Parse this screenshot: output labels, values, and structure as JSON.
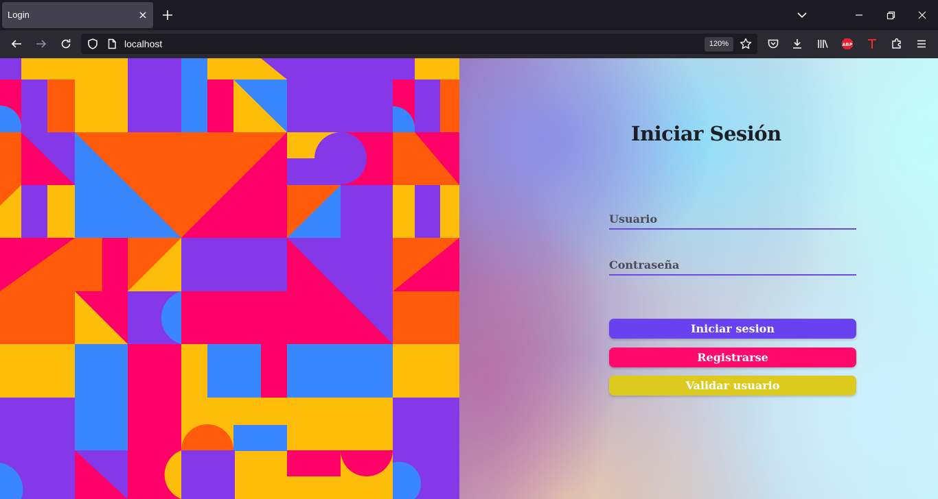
{
  "browser": {
    "tab_title": "Login",
    "url": "localhost",
    "zoom": "120%",
    "theme": {
      "tabbar_bg": "#1c1b22",
      "toolbar_bg": "#2b2a33",
      "active_tab_bg": "#42414d"
    }
  },
  "login": {
    "title": "Iniciar Sesión",
    "username_placeholder": "Usuario",
    "password_placeholder": "Contraseña",
    "buttons": {
      "login": "Iniciar sesion",
      "register": "Registrarse",
      "validate": "Validar usuario"
    },
    "colors": {
      "login_button": "#6841f1",
      "register_button": "#ff0a6c",
      "validate_button": "#dccb1e",
      "field_underline": "#6a4ae0"
    }
  },
  "art_palette": [
    "#8438e8",
    "#ff0068",
    "#ff5b0a",
    "#ffbd0b",
    "#3a86ff"
  ]
}
